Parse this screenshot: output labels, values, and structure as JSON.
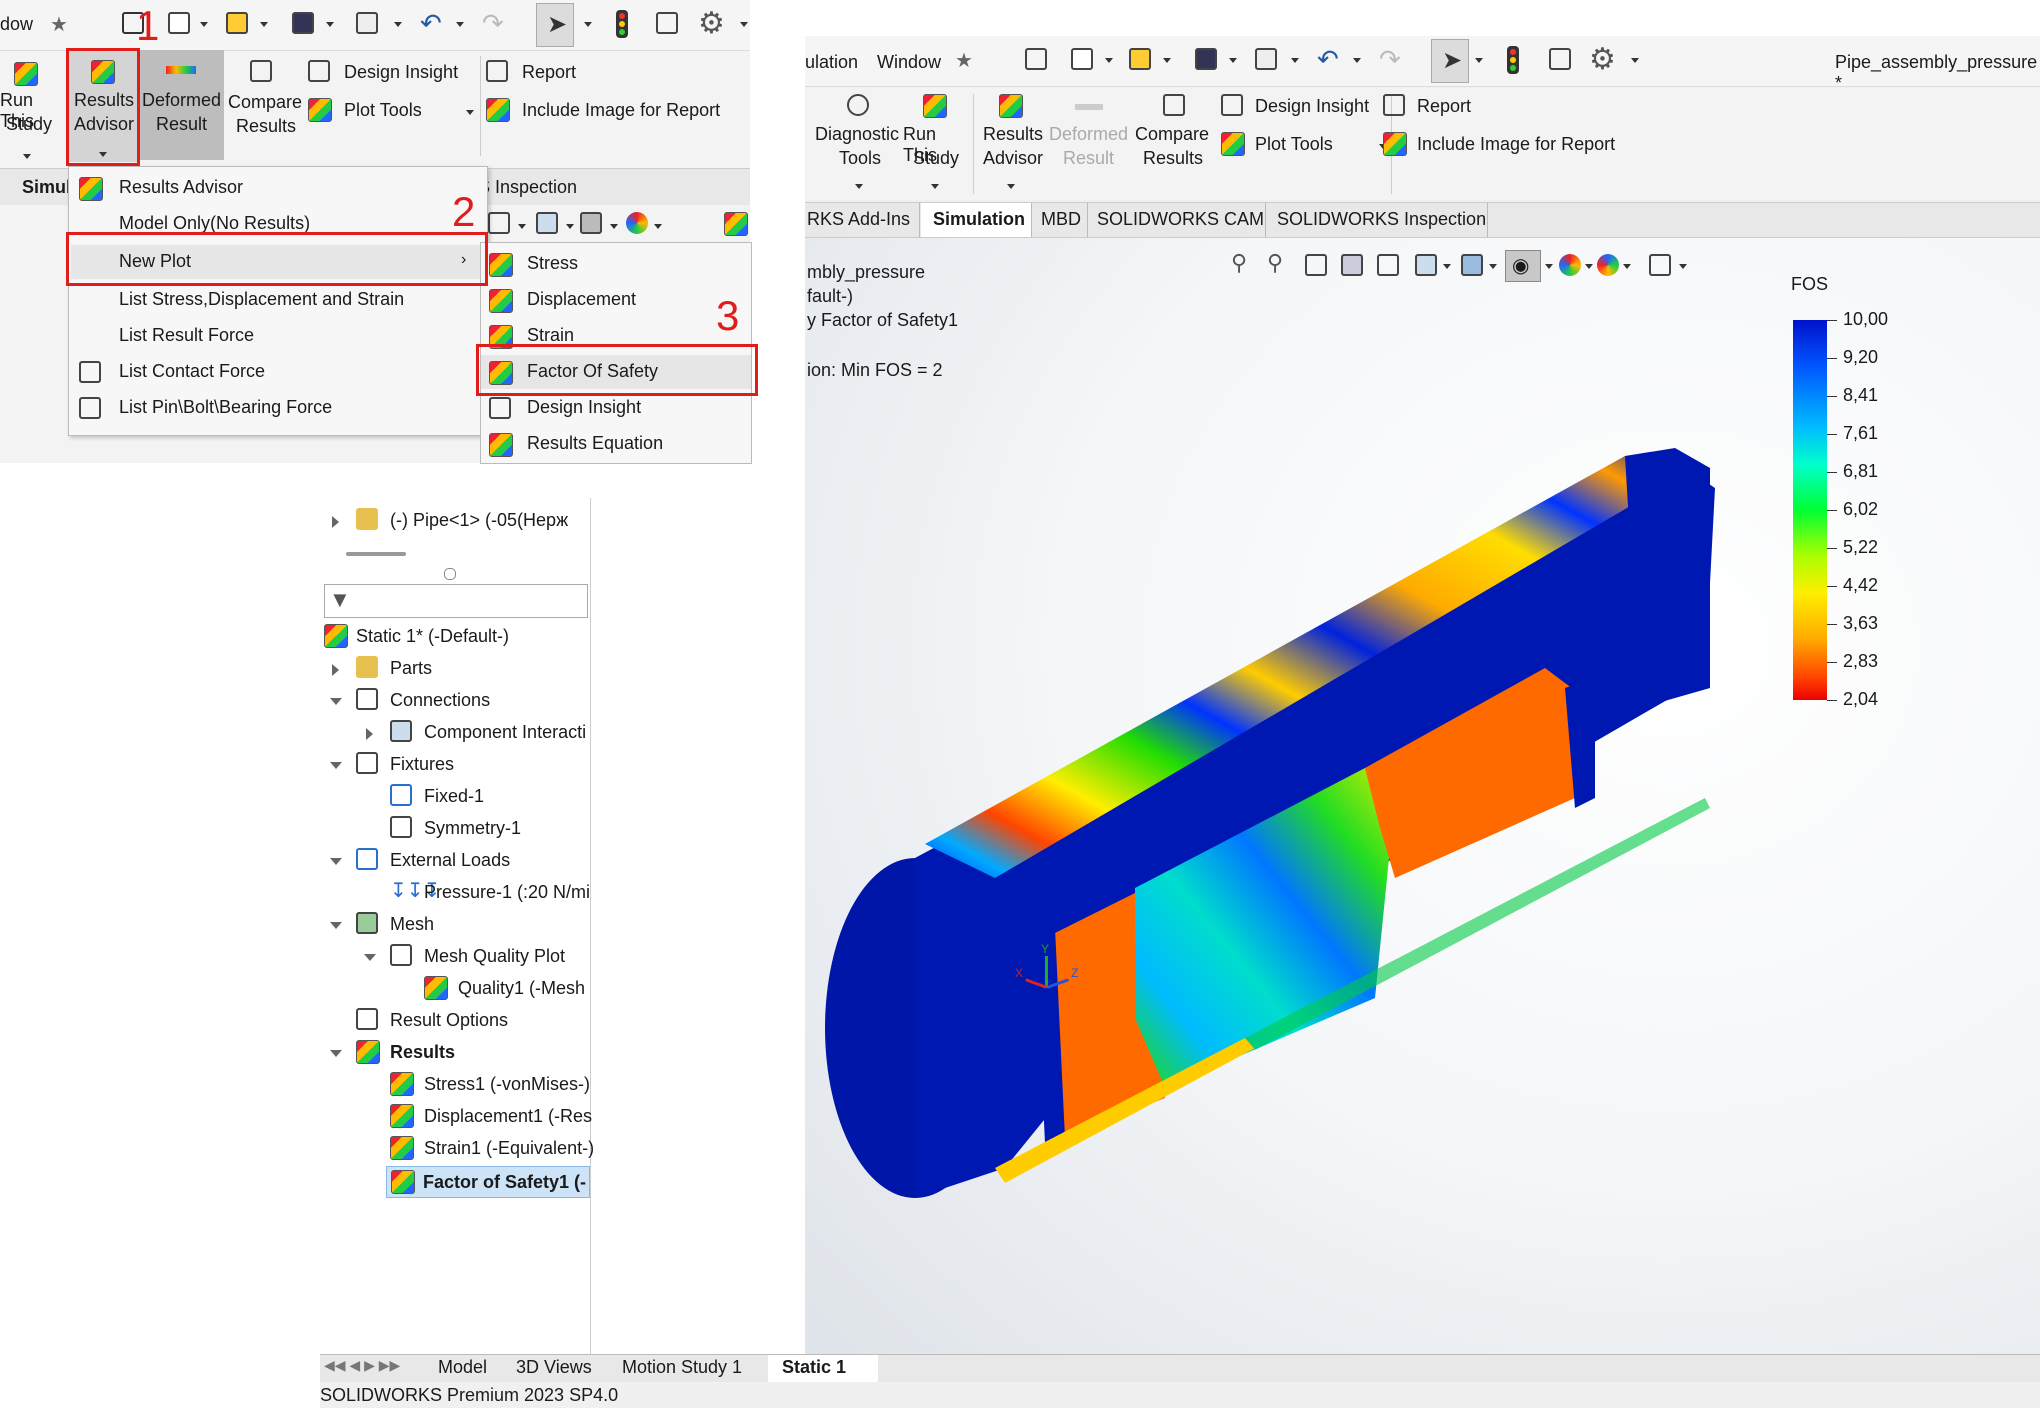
{
  "left_ribbon": {
    "menu_partial": "dow",
    "run_this_study": [
      "Run This",
      "Study"
    ],
    "results_advisor": [
      "Results",
      "Advisor"
    ],
    "deformed_result": [
      "Deformed",
      "Result"
    ],
    "compare_results": [
      "Compare",
      "Results"
    ],
    "design_insight": "Design Insight",
    "plot_tools": "Plot Tools",
    "report": "Report",
    "include_image": "Include Image for Report",
    "tab_partial": "Simul",
    "inspection_partial": "S Inspection"
  },
  "results_menu": {
    "items": [
      "Results Advisor",
      "Model Only(No Results)",
      "New Plot",
      "List Stress,Displacement and Strain",
      "List Result Force",
      "List Contact Force",
      "List Pin\\Bolt\\Bearing Force"
    ]
  },
  "new_plot_submenu": {
    "items": [
      "Stress",
      "Displacement",
      "Strain",
      "Factor Of Safety",
      "Design Insight",
      "Results Equation"
    ]
  },
  "step_numbers": [
    "1",
    "2",
    "3"
  ],
  "right_window": {
    "menu_partial": "ulation",
    "menu_window": "Window",
    "doc_title": "Pipe_assembly_pressure *",
    "diagnostic_tools": [
      "Diagnostic",
      "Tools"
    ],
    "run_this_study": [
      "Run This",
      "Study"
    ],
    "results_advisor": [
      "Results",
      "Advisor"
    ],
    "deformed_result": [
      "Deformed",
      "Result"
    ],
    "compare_results": [
      "Compare",
      "Results"
    ],
    "design_insight": "Design Insight",
    "plot_tools": "Plot Tools",
    "report": "Report",
    "include_image": "Include Image for Report",
    "tabs": [
      "RKS Add-Ins",
      "Simulation",
      "MBD",
      "SOLIDWORKS CAM",
      "SOLIDWORKS Inspection"
    ],
    "viewport_info": [
      "mbly_pressure",
      "fault-)",
      "y Factor of Safety1",
      "",
      "ion: Min FOS = 2"
    ]
  },
  "legend": {
    "title": "FOS",
    "ticks": [
      "10,00",
      "9,20",
      "8,41",
      "7,61",
      "6,81",
      "6,02",
      "5,22",
      "4,42",
      "3,63",
      "2,83",
      "2,04"
    ]
  },
  "tree": {
    "pipe": "(-) Pipe<1> (-05(Нерж",
    "study": "Static 1* (-Default-)",
    "parts": "Parts",
    "connections": "Connections",
    "component_interaction": "Component Interacti",
    "fixtures": "Fixtures",
    "fixed": "Fixed-1",
    "symmetry": "Symmetry-1",
    "external_loads": "External Loads",
    "pressure": "Pressure-1 (:20 N/mi",
    "mesh": "Mesh",
    "mesh_quality_plot": "Mesh Quality Plot",
    "quality": "Quality1 (-Mesh",
    "result_options": "Result Options",
    "results": "Results",
    "stress": "Stress1 (-vonMises-)",
    "displacement": "Displacement1 (-Res",
    "strain": "Strain1 (-Equivalent-)",
    "fos": "Factor of Safety1 (-"
  },
  "bottom_tabs": [
    "Model",
    "3D Views",
    "Motion Study 1",
    "Static 1"
  ],
  "status_bar": "SOLIDWORKS Premium 2023 SP4.0",
  "triad": {
    "x": "X",
    "y": "Y",
    "z": "Z"
  },
  "colors": {
    "highlight_red": "#e21b1b",
    "fos_blue": "#0a1aa8",
    "selection_blue": "#cde3f7"
  }
}
